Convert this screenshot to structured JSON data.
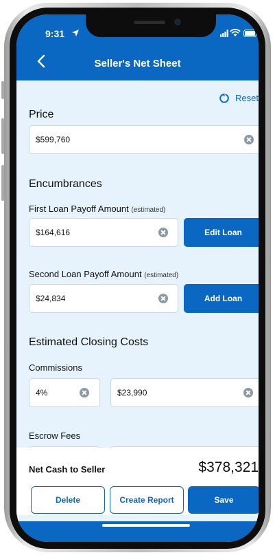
{
  "status_bar": {
    "time": "9:31"
  },
  "header": {
    "title": "Seller's Net Sheet"
  },
  "reset_label": "Reset",
  "price": {
    "label": "Price",
    "value": "$599,760"
  },
  "encumbrances": {
    "heading": "Encumbrances"
  },
  "first_loan": {
    "label": "First Loan Payoff Amount",
    "note": "(estimated)",
    "value": "$164,616",
    "button": "Edit Loan"
  },
  "second_loan": {
    "label": "Second Loan Payoff Amount",
    "note": "(estimated)",
    "value": "$24,834",
    "button": "Add Loan"
  },
  "closing_costs": {
    "heading": "Estimated Closing Costs"
  },
  "commissions": {
    "label": "Commissions",
    "percent": "4%",
    "amount": "$23,990"
  },
  "escrow_fees": {
    "label": "Escrow Fees"
  },
  "summary": {
    "label": "Net Cash to Seller",
    "value": "$378,321"
  },
  "actions": {
    "delete": "Delete",
    "create_report": "Create Report",
    "save": "Save"
  },
  "colors": {
    "primary": "#0a67c2",
    "background": "#e6f3fc"
  }
}
